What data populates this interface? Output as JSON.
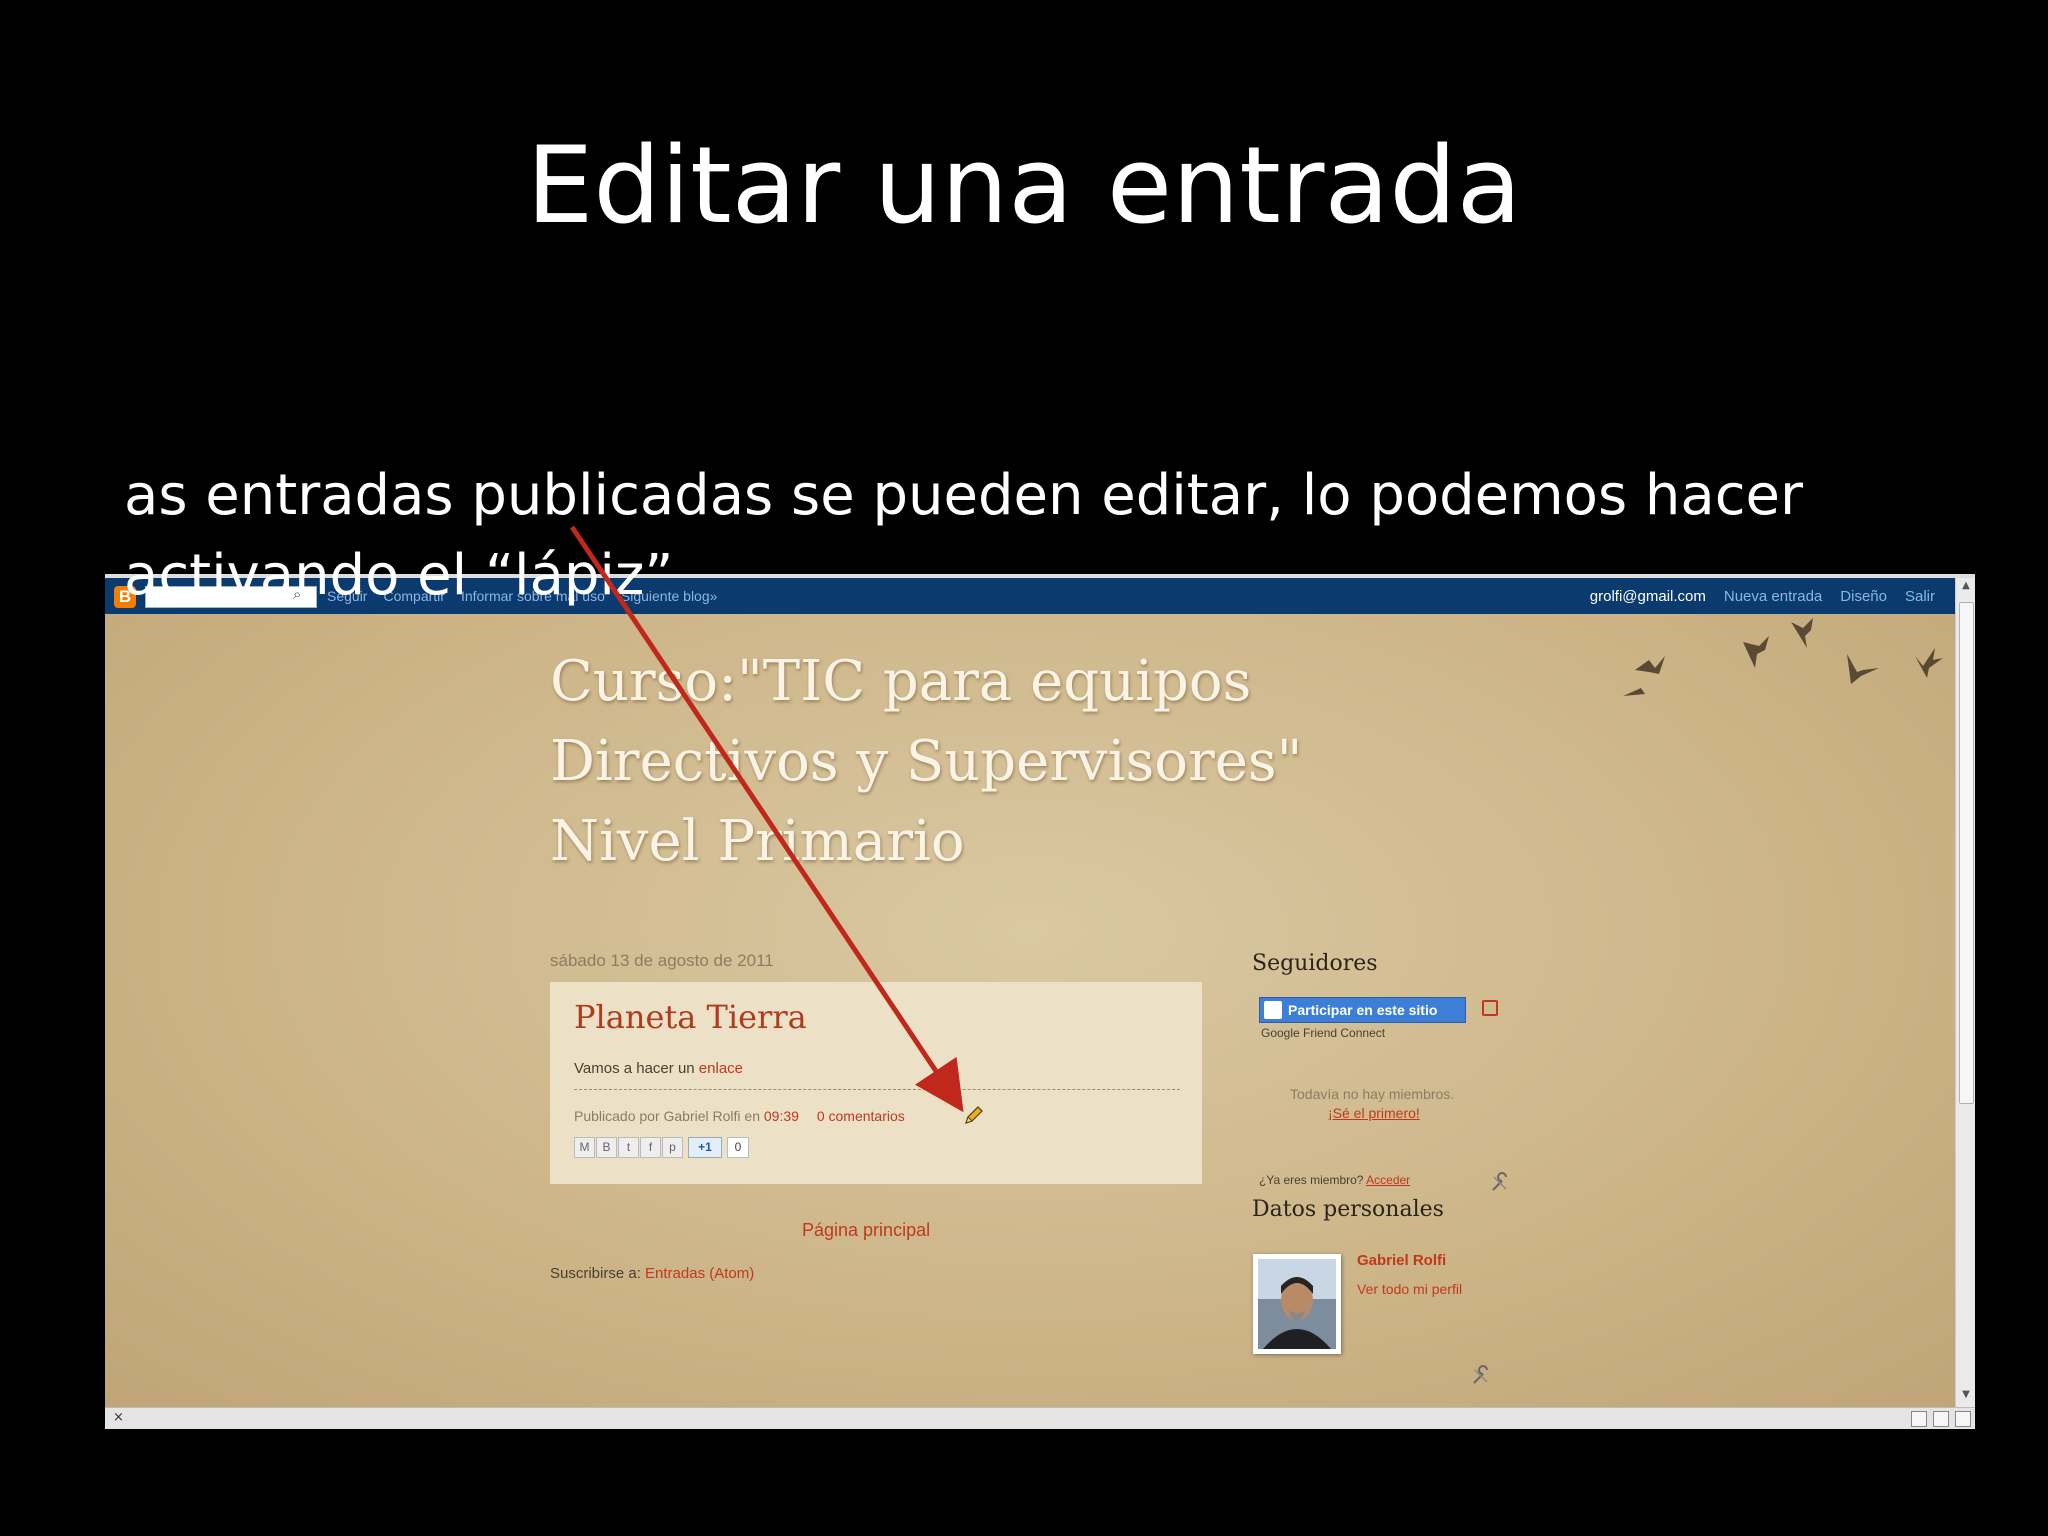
{
  "slide": {
    "title": "Editar una entrada",
    "text_line1": "as entradas publicadas se pueden editar, lo podemos hacer",
    "text_line2": "activando el “lápiz”"
  },
  "navbar": {
    "search_icon": "search-icon",
    "links": [
      "Seguir",
      "Compartir",
      "Informar sobre mal uso",
      "Siguiente blog»"
    ],
    "user_email": "grolfi@gmail.com",
    "new_post": "Nueva entrada",
    "design": "Diseño",
    "sign_out": "Salir"
  },
  "blog": {
    "title_lines": [
      "Curso:\"TIC para equipos",
      "Directivos y Supervisores\"",
      "Nivel Primario"
    ]
  },
  "post": {
    "date": "sábado 13 de agosto de 2011",
    "title": "Planeta Tierra",
    "body_prefix": "Vamos a hacer un",
    "body_link": "enlace",
    "footer_prefix": "Publicado por Gabriel Rolfi en",
    "time": "09:39",
    "comments": "0 comentarios",
    "edit_icon": "pencil-icon",
    "share_icons": [
      "M",
      "B",
      "t",
      "f",
      "p"
    ],
    "plusone": "+1",
    "plusone_count": "0"
  },
  "footer": {
    "home_link": "Página principal",
    "subscribe_prefix": "Suscribirse a:",
    "subscribe_link": "Entradas (Atom)"
  },
  "sidebar": {
    "followers_title": "Seguidores",
    "join_button": "Participar en este sitio",
    "gfc_label": "Google Friend Connect",
    "no_members": "Todavía no hay miembros.",
    "be_first": "¡Sé el primero!",
    "already_member": "¿Ya eres miembro?",
    "sign_in": "Acceder",
    "profile_title": "Datos personales",
    "profile_name": "Gabriel Rolfi",
    "profile_link": "Ver todo mi perfil"
  },
  "statusbar": {
    "close": "×"
  },
  "colors": {
    "navbar": "#0b3a6e",
    "page_bg": "#cdb589",
    "link": "#c0391d",
    "arrow": "#c0281c"
  }
}
